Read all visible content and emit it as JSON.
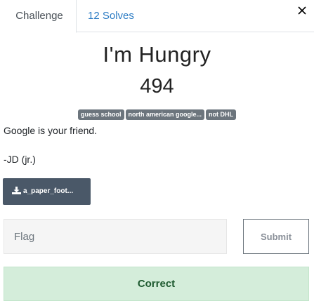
{
  "tabs": {
    "challenge_label": "Challenge",
    "solves_label": "12 Solves"
  },
  "challenge": {
    "name": "I'm Hungry",
    "value": "494",
    "tags": [
      "guess school",
      "north american google...",
      "not DHL"
    ],
    "description_line1": "Google is your friend.",
    "description_line2": "-JD (jr.)",
    "file_label": "a_paper_foot..."
  },
  "flag_form": {
    "placeholder": "Flag",
    "submit_label": "Submit"
  },
  "result": {
    "message": "Correct"
  },
  "icons": {
    "close": "close-icon",
    "download": "download-icon"
  },
  "colors": {
    "tab_link": "#2c7cc4",
    "tag_bg": "#6c757d",
    "file_button_bg": "#4a5868",
    "success_bg": "#d4edda",
    "success_text": "#1e5a30"
  }
}
